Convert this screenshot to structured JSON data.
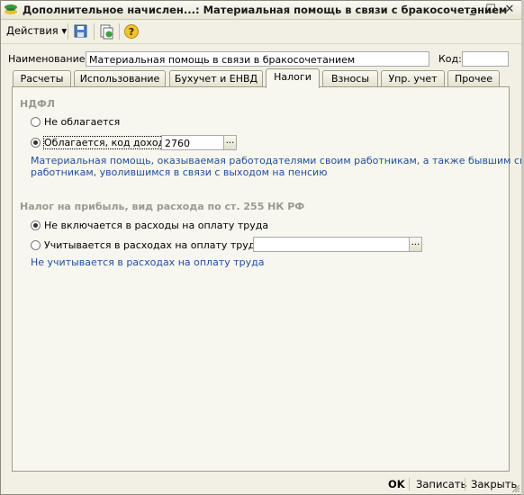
{
  "window": {
    "title": "Дополнительное начислен...: Материальная помощь в связи с бракосочетанием",
    "minimize_label": "_",
    "maximize_label": "☐",
    "close_label": "✕"
  },
  "toolbar": {
    "actions_label": "Действия",
    "actions_arrow": "▾",
    "help_label": "?"
  },
  "fields": {
    "name_label": "Наименование:",
    "name_value": "Материальная помощь в связи в бракосочетанием",
    "code_label": "Код:",
    "code_value": ""
  },
  "tabs": [
    {
      "label": "Расчеты"
    },
    {
      "label": "Использование"
    },
    {
      "label": "Бухучет и ЕНВД"
    },
    {
      "label": "Налоги"
    },
    {
      "label": "Взносы"
    },
    {
      "label": "Упр. учет"
    },
    {
      "label": "Прочее"
    }
  ],
  "active_tab": "Налоги",
  "ndfl": {
    "section_title": "НДФЛ",
    "option_not_taxed": "Не облагается",
    "option_taxed": "Облагается, код дохода:",
    "income_code": "2760",
    "selected": "taxed",
    "hint_line1": "Материальная помощь, оказываемая работодателями своим работникам, а также бывшим своим",
    "hint_line2": "работникам, уволившимся в связи с выходом на пенсию"
  },
  "profit_tax": {
    "section_title": "Налог на прибыль, вид расхода по ст. 255 НК РФ",
    "option_not_included": "Не включается в расходы на оплату труда",
    "option_included": "Учитывается в расходах на оплату труда по:",
    "included_value": "",
    "selected": "not_included",
    "hint": "Не учитывается в расходах на оплату труда"
  },
  "footer": {
    "ok_label": "OK",
    "save_label": "Записать",
    "close_label": "Закрыть"
  },
  "colors": {
    "hint_text": "#1f4e99",
    "section_title": "#9a9890",
    "window_bg": "#f2f0e4",
    "panel_bg": "#f8f7ef"
  }
}
